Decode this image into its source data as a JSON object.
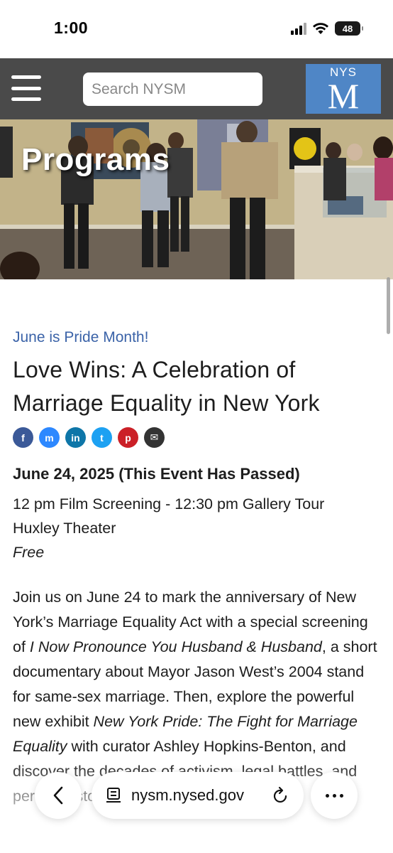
{
  "status_bar": {
    "time": "1:00",
    "battery": "48",
    "icons": [
      "signal-icon",
      "wifi-icon",
      "battery-icon"
    ]
  },
  "header": {
    "menu_icon": "hamburger-icon",
    "search_placeholder": "Search NYSM",
    "logo": {
      "top": "NYS",
      "letter": "M",
      "color": "#4f86c6"
    },
    "background_color": "#4a4a4a"
  },
  "hero": {
    "title": "Programs"
  },
  "event": {
    "kicker": "June is Pride Month!",
    "title": "Love Wins: A Celebration of Marriage Equality in New York",
    "share_icons": [
      {
        "name": "facebook-icon",
        "glyph": "f",
        "color": "#3b5998"
      },
      {
        "name": "messenger-icon",
        "glyph": "m",
        "color": "#2d88ff"
      },
      {
        "name": "linkedin-icon",
        "glyph": "in",
        "color": "#0e76a8"
      },
      {
        "name": "twitter-icon",
        "glyph": "t",
        "color": "#1da1f2"
      },
      {
        "name": "pinterest-icon",
        "glyph": "p",
        "color": "#cb2027"
      },
      {
        "name": "email-icon",
        "glyph": "✉",
        "color": "#333333"
      }
    ],
    "date": "June 24, 2025 (This Event Has Passed)",
    "time_line": "12 pm Film Screening - 12:30 pm Gallery Tour",
    "location": "Huxley Theater",
    "price": "Free",
    "description": {
      "part1": "Join us on June 24 to mark the anniversary of New York’s Marriage Equality Act with a special screening of ",
      "film_title": "I Now Pronounce You Husband & Husband",
      "part2": ", a short documentary about Mayor Jason West’s 2004 stand for same-sex marriage. Then, explore the powerful new exhibit ",
      "exhibit_title": "New York Pride: The Fight for Marriage Equality",
      "part3": " with curator Ashley Hopkins-Benton, and discover the decades of activism, legal battles, and personal stories"
    }
  },
  "browser": {
    "back_icon": "chevron-left-icon",
    "reader_icon": "reader-icon",
    "url": "nysm.nysed.gov",
    "reload_icon": "reload-icon",
    "more_icon": "more-icon"
  }
}
